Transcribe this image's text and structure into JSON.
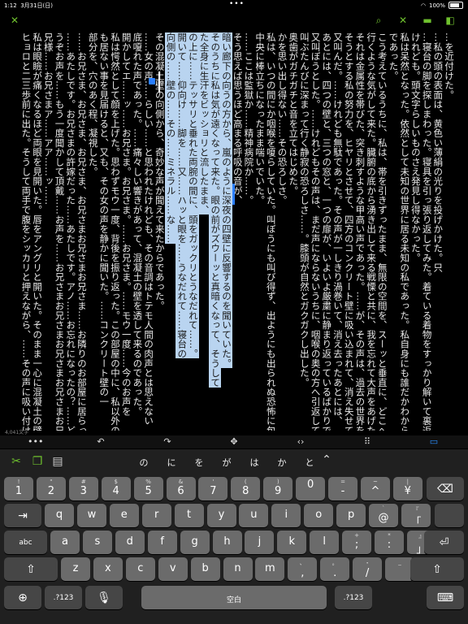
{
  "status": {
    "time": "1:12",
    "date": "3月31日(日)",
    "battery": "100%"
  },
  "editor": {
    "columns": [
      {
        "text": "…を近付けた。",
        "sel": false
      },
      {
        "text": "…私の頭の表面は、黄色い薄絹の光りを投げかけた。只",
        "sel": false
      },
      {
        "text": "…寝台の脚を探しまわった。寝具を引っ張り返してみた。着ている着物をすっかり解いて裏返して見たりした。",
        "sel": false
      },
      {
        "text": "けれども。頭文字らしいものさえ発見し得なかった。",
        "sel": false
      },
      {
        "text": "私は呆然となった。依然として未知の世界に居る未知の私であった。私自身にも誰だかわからない私で",
        "sel": false
      },
      {
        "text": "であった。",
        "sel": false
      },
      {
        "text": "こう考えているうちに、私は、帯を引きずったまま、無限の空間を、スーッと垂直に、どこへか落ちて",
        "sel": false
      },
      {
        "text": "行くような気がして来た。臓腑の底から湧き出して来る戦慄と共に、我を忘れて大声をあげた。",
        "sel": false
      },
      {
        "text": "それは金属性を帯びた、突き刺すような甲高い声であった。……が、その声は、過去の世界を思い出",
        "sel": false
      },
      {
        "text": "そうとする私の努力を、ヒヤリとさせて、四方のコンクリート壁に吸い込まれて、消え失せてしまった。",
        "sel": false
      },
      {
        "text": "又叫んだ。……けれども無駄であった。その声が一しきり渦巻いて、消え去ったあとには、",
        "sel": false
      },
      {
        "text": "あとには、四つの壁と、三つの窓と、一つの扉が、いよいよ厳粛に静まり返っているばかりであった。",
        "sel": false
      },
      {
        "text": "又叫ぼうとした。……けれどもその声は、まだ声にならないうちに、咽喉の奥の方へ引返してしまった。",
        "sel": false
      },
      {
        "text": "叫ぶたんびに深まって行く静寂の恐ろしさ……。膝頭が自然とガクガクし出した。",
        "sel": false
      },
      {
        "text": "奥歯がガチガチと音を立てはじめた。",
        "sel": false
      },
      {
        "text": "かを思い出し得ない……その恐ろしさ。",
        "sel": false
      },
      {
        "text": "私は、いつの間にか咽喉を嗄らしていた。叫ぼうにも叫び得ず、出ようにも出られぬ恐怖に包まれて、部屋の",
        "sel": false
      },
      {
        "text": "中央に棒立ちになったまま喘いでいた。",
        "sel": false
      },
      {
        "text": "……ここは監獄か……精神病院か……。",
        "sel": false
      },
      {
        "text": "そう思えば思うほど高まる呼吸の音が、",
        "sel": false
      },
      {
        "text": "暗い廊下の向うの方から、嵐のように深夜の四壁に反響するのを聞いていた。",
        "sel": true
      },
      {
        "text": "そのうちに私は気が遠くなって来た。眼の前がズウーッと真暗くなって、そうして",
        "sel": true
      },
      {
        "text": "た全身に生汗をビッショリと流したまま、",
        "sel": true
      },
      {
        "text": "の上に……テッサリと垂れた両腕の間に、頭をガックリとうなだれて……。",
        "sel": true
      },
      {
        "text": "開いて……仰向け……脚を……又……ハッと眼を……うなだれて……寝台の",
        "sel": true
      },
      {
        "text": "向側の……壁の……その……ミネラル……な……",
        "sel": true
      },
      {
        "text": "その混凝土壁の向側から、奇妙な声が聞えて来たからであった。",
        "sel": false
      },
      {
        "text": "……女の声……らしい……と思われたけれども、その音調はトテモ人間の肉声とは思えない",
        "sel": false
      },
      {
        "text": "底嗄れた声であった。……痛々しい響きがあって、混凝土の壁を透して来るのであった。",
        "sel": false
      },
      {
        "text": "開かしてエ……ッ……お兄さま。お兄さま。……お兄さま。……モウ一度……今のお声を",
        "sel": false
      },
      {
        "text": "私は愕然として顔を上げた。思わずモウ一度、背後を振り返った。この部屋の中に、私以外の人間が一人",
        "sel": false
      },
      {
        "text": "も居ない事を見届けると、又も、その女の声を静かに聞いた。……コンクリート壁の一",
        "sel": false
      },
      {
        "text": "部分を、穴のあく程、凝視した。",
        "sel": false
      },
      {
        "text": "……お兄さま、お兄さま、お兄さま、お兄さまお兄さまお兄さま……お隣りのお部屋に居らっしゃるお兄さま……あたしです",
        "sel": false
      },
      {
        "text": "……あたしです。お兄さまの許嫁だった……あたしです。アノ……お忘れになったの？……どうぞ……もう",
        "sel": false
      },
      {
        "text": "うぞお声を……もう一度聞かして頂戴……お声を……お兄さまお兄さまお兄さまお兄さまお兄さま……",
        "sel": false
      },
      {
        "text": "兄様……お兄さまア……アア……ッ……",
        "sel": false
      },
      {
        "text": "私は眼瞼が痛くなるほど両眼を見開いた。唇をアングリと開いた。そのまま一心に混凝土の壁を白眼",
        "sel": false
      },
      {
        "text": "ヒョロと二三歩前に出た。そうして両手で腹をシッカリと押えながら、……その声に吸い付けられるように……ヒョロ",
        "sel": false
      }
    ],
    "word_count": "4,041文字"
  },
  "candidates": [
    "の",
    "に",
    "を",
    "が",
    "は",
    "か",
    "と"
  ],
  "keyboard": {
    "row1": [
      [
        "!",
        "1"
      ],
      [
        "\"",
        "2"
      ],
      [
        "#",
        "3"
      ],
      [
        "$",
        "4"
      ],
      [
        "%",
        "5"
      ],
      [
        "&",
        "6"
      ],
      [
        "'",
        "7"
      ],
      [
        "(",
        "8"
      ],
      [
        ")",
        "9"
      ],
      [
        "",
        "0"
      ],
      [
        "=",
        "-"
      ],
      [
        "~",
        "^"
      ],
      [
        "|",
        "¥"
      ]
    ],
    "row2": [
      "q",
      "w",
      "e",
      "r",
      "t",
      "y",
      "u",
      "i",
      "o",
      "p"
    ],
    "row2_extra": [
      [
        "`",
        "@"
      ],
      [
        "『",
        "「"
      ]
    ],
    "row3": [
      "a",
      "s",
      "d",
      "f",
      "g",
      "h",
      "j",
      "k",
      "l"
    ],
    "row3_extra": [
      [
        "+",
        ";"
      ],
      [
        "*",
        ":"
      ],
      [
        "』",
        "」"
      ]
    ],
    "row3_abc": "abc",
    "row4": [
      "z",
      "x",
      "c",
      "v",
      "b",
      "n",
      "m"
    ],
    "row4_extra": [
      [
        "、",
        ","
      ],
      [
        "。",
        "."
      ],
      [
        "・",
        "/"
      ],
      [
        "_",
        ""
      ]
    ],
    "num_left": ".?123",
    "num_right": ".?123",
    "space": "空白"
  }
}
